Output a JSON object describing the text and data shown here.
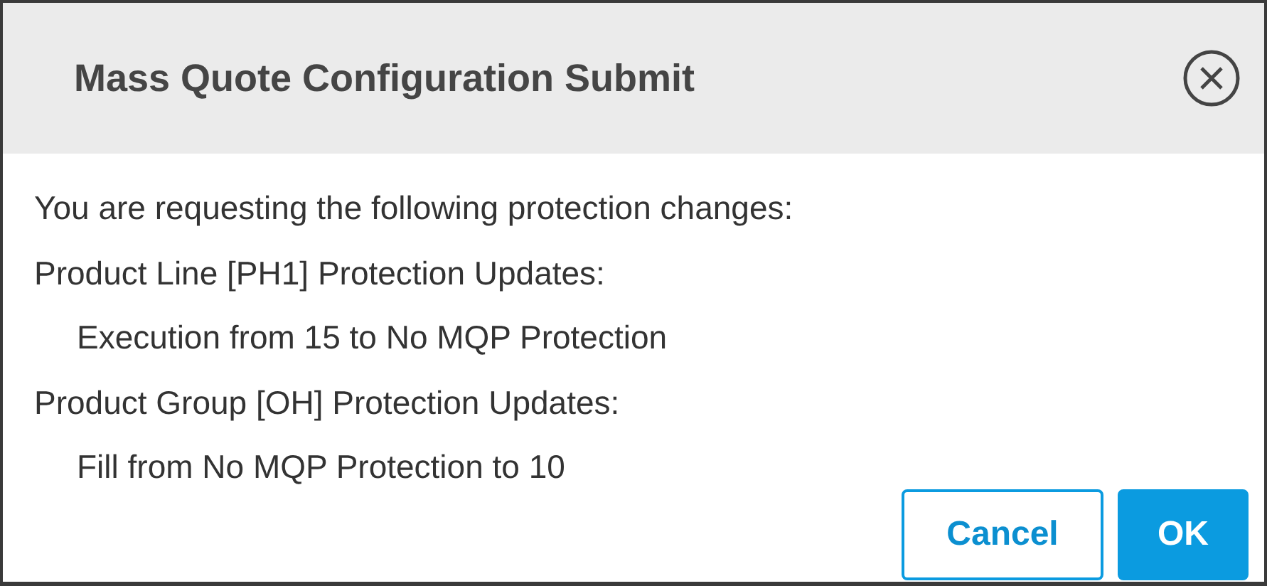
{
  "dialog": {
    "title": "Mass Quote Configuration Submit"
  },
  "lines": [
    {
      "kind": "heading",
      "text": "You are requesting the following protection changes:"
    },
    {
      "kind": "heading",
      "text": "Product Line [PH1] Protection Updates:"
    },
    {
      "kind": "detail",
      "text": "Execution from 15 to No MQP Protection"
    },
    {
      "kind": "heading",
      "text": "Product Group [OH] Protection Updates:"
    },
    {
      "kind": "detail",
      "text": "Fill from No MQP Protection to 10"
    }
  ],
  "buttons": [
    {
      "kind": "secondary",
      "label": "Cancel"
    },
    {
      "kind": "primary",
      "label": "OK"
    }
  ]
}
